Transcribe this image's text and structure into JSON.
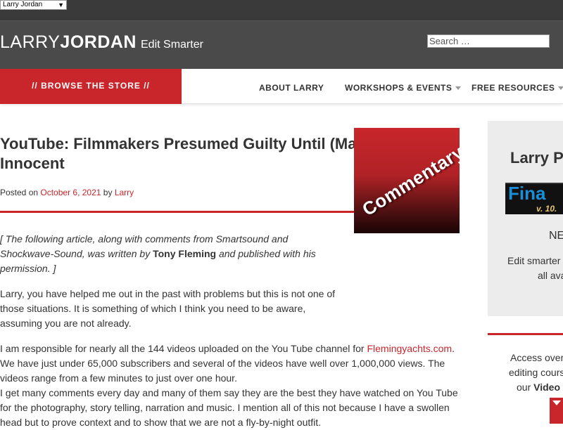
{
  "topbar": {
    "site_select": "Larry Jordan"
  },
  "header": {
    "logo_light": "LARRY",
    "logo_bold": "JORDAN",
    "tagline": "Edit Smarter",
    "search_placeholder": "Search …"
  },
  "nav": {
    "store_label": "// BROWSE THE STORE //",
    "items": [
      {
        "label": "ABOUT LARRY"
      },
      {
        "label": "WORKSHOPS & EVENTS"
      },
      {
        "label": "FREE RESOURCES"
      }
    ]
  },
  "article": {
    "title": "YouTube: Filmmakers Presumed Guilty Until (Maybe) Proven Innocent",
    "meta": {
      "posted_on": "Posted on",
      "date": "October 6, 2021",
      "by": "by",
      "author": "Larry"
    },
    "image_text": "Commentary",
    "intro_italic_1": "[ The following article, along with comments from Smartsound and Shockwave-Sound, was written by ",
    "intro_bold": "Tony Fleming",
    "intro_italic_2": " and published with his permission. ]",
    "p2": "Larry, you have helped me out in the past with problems but this is not one of those situations. It is something of which I think you need to be aware, assuming you are not already.",
    "p3_a": "I am responsible for nearly all the 144 videos uploaded on the You Tube channel for ",
    "p3_link": "Flemingyachts.com",
    "p3_b": ". We have just under 65,000 subscribers and several of the videos have well over 1,000,000 views. The videos range from a few minutes to just over one hour.",
    "p4": "I get many comments every day and many of them say they are the best they have watched on You Tube for the photography, story telling, narration and music. I mention all of this not because I have a swollen head but to prove context and to show that we are not a fly-by-night outfit."
  },
  "sidebar": {
    "widget1": {
      "title": "Larry P",
      "banner_main": "Fina",
      "banner_sub": "v. 10.",
      "new_label": "NE",
      "desc_1": "Edit smarter",
      "desc_2": "all ava"
    },
    "widget2": {
      "line_1": "Access over",
      "line_2": "editing cours",
      "line_3_a": "our ",
      "line_3_b": "Video"
    }
  },
  "colors": {
    "accent": "#c8262b",
    "header_bg": "#4a4a4a",
    "topbar_bg": "#3a3a3a"
  }
}
